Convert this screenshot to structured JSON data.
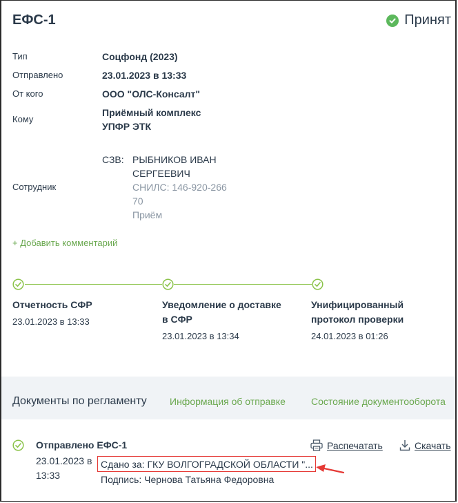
{
  "header": {
    "title": "ЕФС-1",
    "status": "Принят",
    "status_color": "#5cb85c"
  },
  "details": {
    "type_label": "Тип",
    "type_value": "Соцфонд (2023)",
    "sent_label": "Отправлено",
    "sent_value": "23.01.2023 в 13:33",
    "from_label": "От кого",
    "from_value": "ООО \"ОЛС-Консалт\"",
    "to_label": "Кому",
    "to_value_line1": "Приёмный комплекс",
    "to_value_line2": "УПФР ЭТК",
    "employee_label": "Сотрудник",
    "employee_prefix": "СЗВ:",
    "employee_name_line1": "РЫБНИКОВ ИВАН",
    "employee_name_line2": "СЕРГЕЕВИЧ",
    "employee_snils_line1": "СНИЛС: 146-920-266",
    "employee_snils_line2": "70",
    "employee_status": "Приём"
  },
  "add_comment": "+ Добавить комментарий",
  "steps": [
    {
      "title_line1": "Отчетность СФР",
      "title_line2": "",
      "date": "23.01.2023 в 13:33"
    },
    {
      "title_line1": "Уведомление о доставке",
      "title_line2": "в СФР",
      "date": "23.01.2023 в 13:34"
    },
    {
      "title_line1": "Унифицированный",
      "title_line2": "протокол проверки",
      "date": "24.01.2023 в 01:26"
    }
  ],
  "tabs": {
    "main": "Документы по регламенту",
    "info": "Информация об отправке",
    "state": "Состояние документооборота"
  },
  "document": {
    "title": "Отправлено ЕФС-1",
    "date_line1": "23.01.2023 в",
    "date_line2": "13:33",
    "sent_to": "Сдано за: ГКУ ВОЛГОГРАДСКОЙ ОБЛАСТИ \"...",
    "signature": "Подпись: Чернова Татьяна Федоровна",
    "print": "Распечатать",
    "download": "Скачать"
  },
  "colors": {
    "accent_green": "#6aa84f",
    "highlight_red": "#e53935"
  }
}
